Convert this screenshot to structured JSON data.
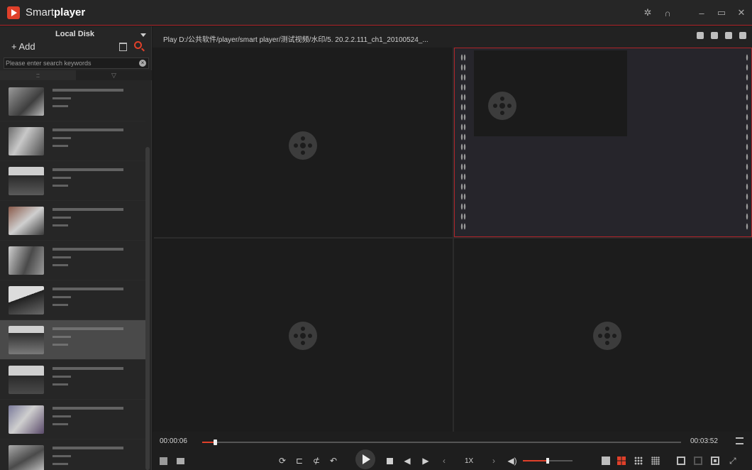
{
  "app": {
    "title_light": "Smart",
    "title_bold": "player"
  },
  "titlebar": {
    "icons": [
      "settings-icon",
      "headset-icon",
      "minimize-icon",
      "maximize-icon",
      "close-icon"
    ]
  },
  "sidebar": {
    "disk_label": "Local Disk",
    "add_label": "+ Add",
    "search_placeholder": "Please enter search keywords",
    "view_tabs": [
      "::",
      "▽"
    ],
    "file_count": 10,
    "selected_index": 6
  },
  "path": {
    "text": "Play  D:/公共软件/player/smart player/测试视频/水印/5.  20.2.2.111_ch1_20100524_..."
  },
  "playback": {
    "current_time": "00:00:06",
    "total_time": "00:03:52",
    "progress": 0.027,
    "speed": "1X",
    "volume": 0.5
  },
  "colors": {
    "accent": "#e0402a",
    "background": "#1b1b1b",
    "panel": "#262626"
  }
}
